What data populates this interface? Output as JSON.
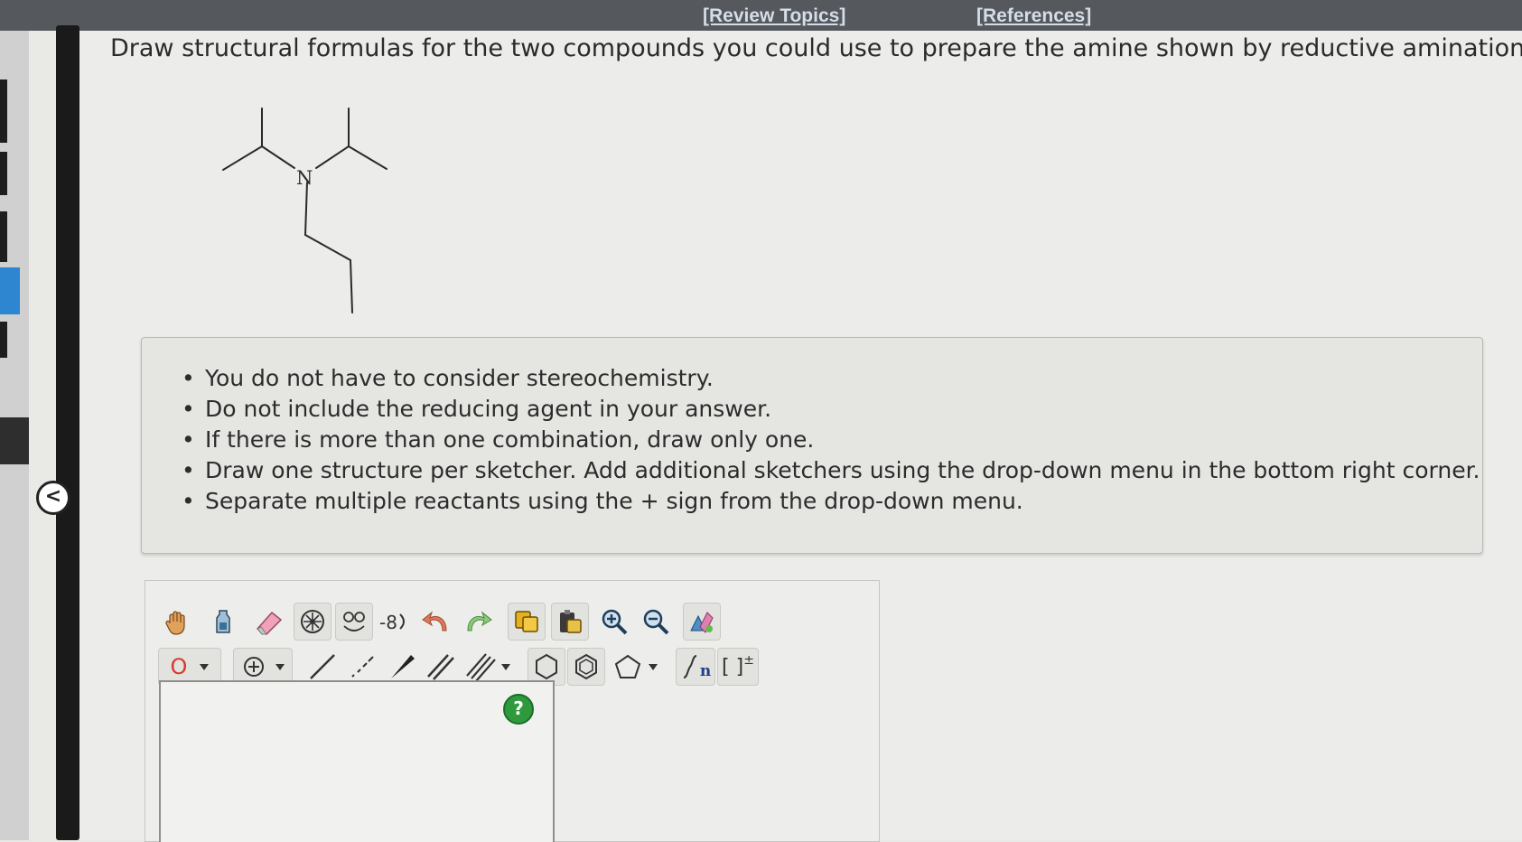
{
  "header": {
    "review_topics": "[Review Topics]",
    "references": "[References]"
  },
  "question": {
    "text": "Draw structural formulas for the two compounds you could use to prepare the amine shown by reductive amination.",
    "molecule_atom_label": "N"
  },
  "instructions": [
    "You do not have to consider stereochemistry.",
    "Do not include the reducing agent in your answer.",
    "If there is more than one combination, draw only one.",
    "Draw one structure per sketcher. Add additional sketchers using the drop-down menu in the bottom right corner.",
    "Separate multiple reactants using the + sign from the drop-down menu."
  ],
  "toolbar": {
    "atom_selector": "O",
    "template_label": "n",
    "bracket_label": "[ ]",
    "bracket_charge": "±"
  },
  "canvas": {
    "help_label": "?"
  },
  "sidebar": {
    "collapse_label": "<"
  },
  "colors": {
    "top_bar": "#55585c",
    "link": "#d5dde8",
    "help_button": "#2f9a3d",
    "atom_red": "#d63a2e",
    "blue_tab": "#2e86d1"
  }
}
